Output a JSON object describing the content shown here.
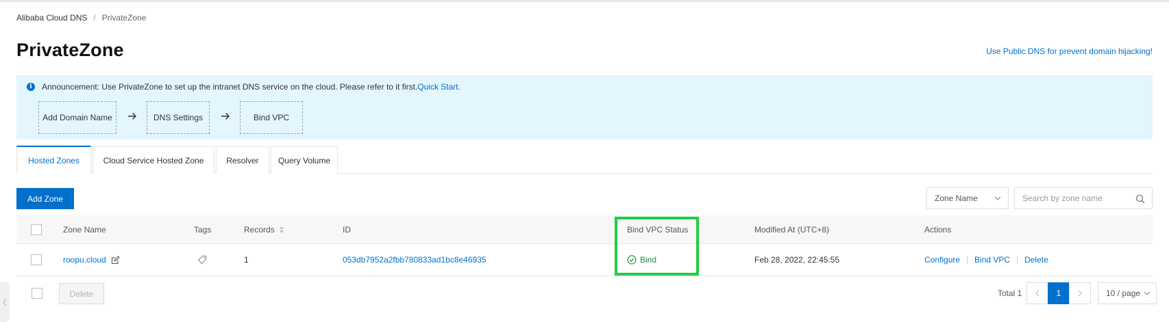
{
  "breadcrumb": {
    "root": "Alibaba Cloud DNS",
    "separator": "/",
    "current": "PrivateZone"
  },
  "page_title": "PrivateZone",
  "top_link": "Use Public DNS for prevent domain hijacking!",
  "announcement": {
    "text": "Announcement: Use PrivateZone to set up the intranet DNS service on the cloud. Please refer to it first.",
    "link": "Quick Start.",
    "steps": [
      "Add Domain Name",
      "DNS Settings",
      "Bind VPC"
    ]
  },
  "tabs": [
    {
      "label": "Hosted Zones",
      "active": true
    },
    {
      "label": "Cloud Service Hosted Zone",
      "active": false
    },
    {
      "label": "Resolver",
      "active": false
    },
    {
      "label": "Query Volume",
      "active": false
    }
  ],
  "toolbar": {
    "add_zone_label": "Add Zone",
    "filter_select_value": "Zone Name",
    "search_placeholder": "Search by zone name"
  },
  "table": {
    "headers": {
      "zone_name": "Zone Name",
      "tags": "Tags",
      "records": "Records",
      "id": "ID",
      "bind_vpc_status": "Bind VPC Status",
      "modified_at": "Modified At (UTC+8)",
      "actions": "Actions"
    },
    "rows": [
      {
        "zone_name": "roopu.cloud",
        "records": "1",
        "id": "053db7952a2fbb780833ad1bc8e46935",
        "bind_vpc_status": "Bind",
        "modified_at": "Feb 28, 2022, 22:45:55",
        "actions": [
          "Configure",
          "Bind VPC",
          "Delete"
        ]
      }
    ]
  },
  "footer": {
    "delete_label": "Delete",
    "total_label": "Total 1",
    "current_page": "1",
    "page_size": "10 / page"
  },
  "colors": {
    "primary": "#0070cc",
    "announcement_bg": "#e3f5fd",
    "status_success": "#1e8e3e",
    "highlight": "#22cc44"
  }
}
